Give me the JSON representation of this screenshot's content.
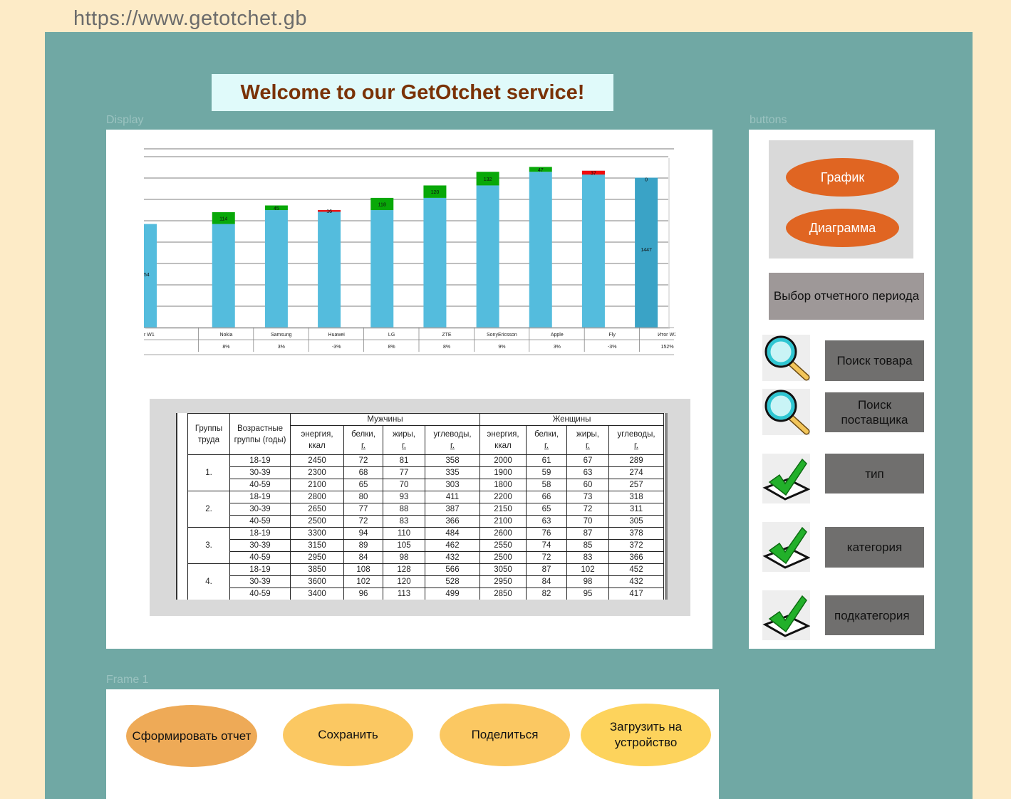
{
  "url": "https://www.getotchet.gb",
  "welcome": "Welcome to our GetOtchet service!",
  "labels": {
    "display": "Display",
    "buttons": "buttons",
    "frame1": "Frame 1"
  },
  "chart_data": {
    "type": "bar",
    "categories": [
      "r W1",
      "Nokia",
      "Samsung",
      "Huawei",
      "LG",
      "ZTE",
      "SonyEricsson",
      "Apple",
      "Fly",
      "Итог W2"
    ],
    "percents": [
      "",
      "8%",
      "3%",
      "-3%",
      "8%",
      "8%",
      "9%",
      "3%",
      "-3%",
      "152%"
    ],
    "base": [
      1000,
      1000,
      1134,
      1134,
      1134,
      1252,
      1372,
      1504,
      1514,
      0
    ],
    "delta": [
      null,
      114,
      45,
      -16,
      118,
      120,
      132,
      47,
      -37,
      0
    ],
    "base_labels": [
      "54",
      "",
      "",
      "",
      "",
      "",
      "",
      "",
      "",
      "1447"
    ],
    "ylim": [
      0,
      1650
    ],
    "colors": {
      "bar": "#54bcdd",
      "total": "#3aa3c6",
      "increase": "#08a808",
      "decrease": "#f20a0a"
    }
  },
  "table": {
    "headers": {
      "group": "Группы труда",
      "age": "Возрастные группы (годы)",
      "men": "Мужчины",
      "women": "Женщины",
      "cols": [
        "энергия, ккал",
        "белки, г.",
        "жиры, г.",
        "углеводы, г.",
        "энергия, ккал",
        "белки, г.",
        "жиры, г.",
        "углеводы, г."
      ]
    },
    "groups": [
      {
        "id": "1.",
        "rows": [
          {
            "age": "18-19",
            "v": [
              "2450",
              "72",
              "81",
              "358",
              "2000",
              "61",
              "67",
              "289"
            ]
          },
          {
            "age": "30-39",
            "v": [
              "2300",
              "68",
              "77",
              "335",
              "1900",
              "59",
              "63",
              "274"
            ]
          },
          {
            "age": "40-59",
            "v": [
              "2100",
              "65",
              "70",
              "303",
              "1800",
              "58",
              "60",
              "257"
            ]
          }
        ]
      },
      {
        "id": "2.",
        "rows": [
          {
            "age": "18-19",
            "v": [
              "2800",
              "80",
              "93",
              "411",
              "2200",
              "66",
              "73",
              "318"
            ]
          },
          {
            "age": "30-39",
            "v": [
              "2650",
              "77",
              "88",
              "387",
              "2150",
              "65",
              "72",
              "311"
            ]
          },
          {
            "age": "40-59",
            "v": [
              "2500",
              "72",
              "83",
              "366",
              "2100",
              "63",
              "70",
              "305"
            ]
          }
        ]
      },
      {
        "id": "3.",
        "rows": [
          {
            "age": "18-19",
            "v": [
              "3300",
              "94",
              "110",
              "484",
              "2600",
              "76",
              "87",
              "378"
            ]
          },
          {
            "age": "30-39",
            "v": [
              "3150",
              "89",
              "105",
              "462",
              "2550",
              "74",
              "85",
              "372"
            ]
          },
          {
            "age": "40-59",
            "v": [
              "2950",
              "84",
              "98",
              "432",
              "2500",
              "72",
              "83",
              "366"
            ]
          }
        ]
      },
      {
        "id": "4.",
        "rows": [
          {
            "age": "18-19",
            "v": [
              "3850",
              "108",
              "128",
              "566",
              "3050",
              "87",
              "102",
              "452"
            ]
          },
          {
            "age": "30-39",
            "v": [
              "3600",
              "102",
              "120",
              "528",
              "2950",
              "84",
              "98",
              "432"
            ]
          },
          {
            "age": "40-59",
            "v": [
              "3400",
              "96",
              "113",
              "499",
              "2850",
              "82",
              "95",
              "417"
            ]
          }
        ]
      }
    ]
  },
  "side": {
    "graph": "График",
    "diagram": "Диаграмма",
    "period": "Выбор отчетного периода",
    "search_product": "Поиск товара",
    "search_supplier": "Поиск поставщика",
    "type": "тип",
    "category": "категория",
    "subcategory": "подкатегория"
  },
  "actions": {
    "generate": "Сформировать отчет",
    "save": "Сохранить",
    "share": "Поделиться",
    "download": "Загрузить на устройство"
  }
}
